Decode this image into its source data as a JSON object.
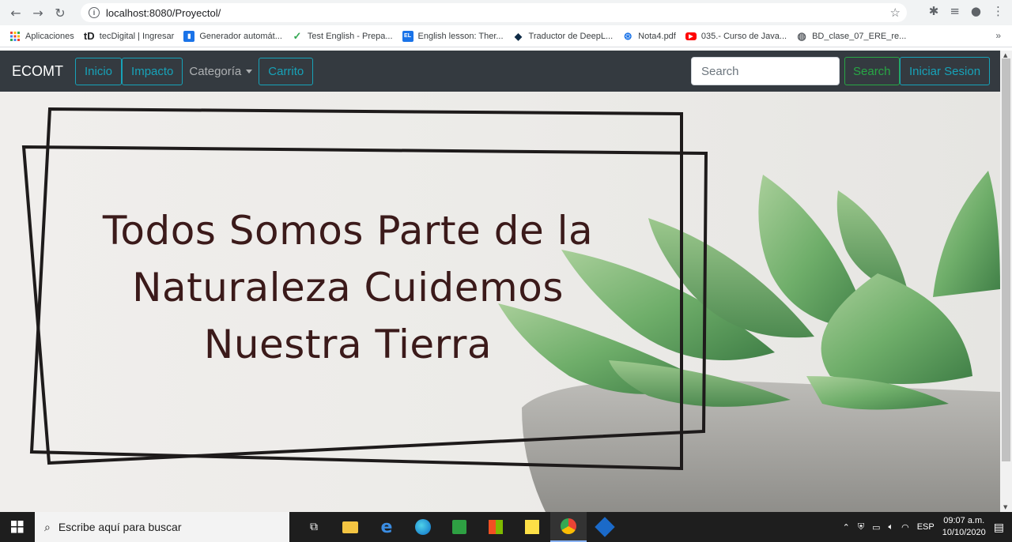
{
  "browser": {
    "url": "localhost:8080/Proyectol/",
    "bookmarks": [
      {
        "label": "Aplicaciones",
        "icon": "apps-grid-icon",
        "color": "#ea4335"
      },
      {
        "label": "tecDigital | Ingresar",
        "icon": "td-icon",
        "color": "#202124"
      },
      {
        "label": "Generador automát...",
        "icon": "doc-icon",
        "color": "#1a73e8"
      },
      {
        "label": "Test English - Prepa...",
        "icon": "check-icon",
        "color": "#34a853"
      },
      {
        "label": "English lesson: Ther...",
        "icon": "flag-icon",
        "color": "#1a73e8"
      },
      {
        "label": "Traductor de DeepL...",
        "icon": "deepl-icon",
        "color": "#0f2b46"
      },
      {
        "label": "Nota4.pdf",
        "icon": "pdf-icon",
        "color": "#1a73e8"
      },
      {
        "label": "035.- Curso de Java...",
        "icon": "youtube-icon",
        "color": "#ff0000"
      },
      {
        "label": "BD_clase_07_ERE_re...",
        "icon": "globe-icon",
        "color": "#5f6368"
      }
    ],
    "bookmarks_more": "»"
  },
  "navbar": {
    "brand": "ECOMT",
    "inicio": "Inicio",
    "impacto": "Impacto",
    "categoria": "Categoría",
    "carrito": "Carrito",
    "search_placeholder": "Search",
    "search_button": "Search",
    "login_button": "Iniciar Sesion"
  },
  "hero": {
    "line1": "Todos Somos Parte de la",
    "line2": "Naturaleza Cuidemos",
    "line3": "Nuestra Tierra"
  },
  "taskbar": {
    "search_placeholder": "Escribe aquí para buscar",
    "language": "ESP",
    "time": "09:07 a.m.",
    "date": "10/10/2020"
  }
}
